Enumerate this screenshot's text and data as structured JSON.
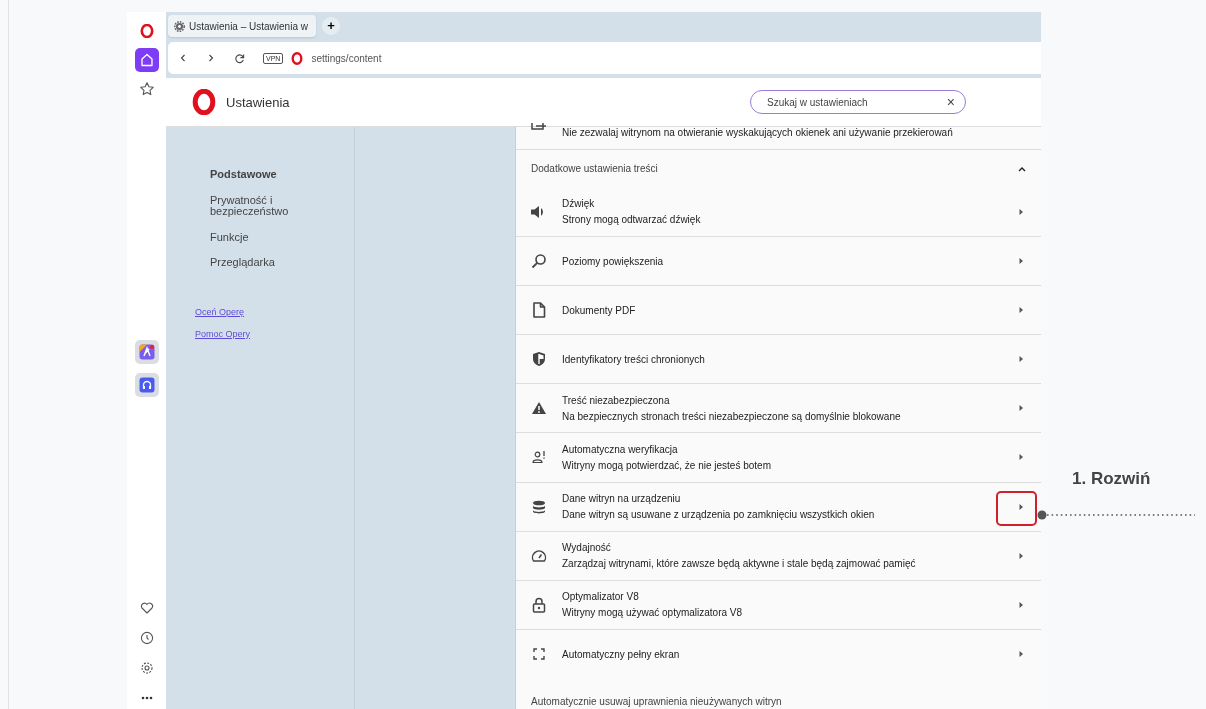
{
  "sidebar": {
    "items": [
      {
        "kind": "logo",
        "selected": false
      },
      {
        "kind": "home",
        "selected": true
      },
      {
        "kind": "star",
        "selected": false
      },
      {
        "kind": "app-a",
        "selected": false
      },
      {
        "kind": "app-b",
        "selected": false
      },
      {
        "kind": "heart",
        "selected": false
      },
      {
        "kind": "clock",
        "selected": false
      },
      {
        "kind": "gear",
        "selected": false
      },
      {
        "kind": "more",
        "selected": false
      }
    ]
  },
  "tabs": [
    {
      "title": "Ustawienia – Ustawienia w",
      "selected": true
    }
  ],
  "new_tab": "+",
  "address": {
    "vpn": "VPN",
    "url": "settings/content"
  },
  "header": {
    "title": "Ustawienia",
    "search_placeholder": "Szukaj w ustawieniach",
    "clear": "×"
  },
  "nav": {
    "items": [
      {
        "label": "Podstawowe",
        "selected": true
      },
      {
        "label": "Prywatność i bezpieczeństwo",
        "selected": false
      },
      {
        "label": "Funkcje",
        "selected": false
      },
      {
        "label": "Przeglądarka",
        "selected": false
      }
    ],
    "links": [
      "Oceń Operę",
      "Pomoc Opery"
    ]
  },
  "content": {
    "partial_row": {
      "subtitle": "Nie zezwalaj witrynom na otwieranie wyskakujących okienek ani używanie przekierowań"
    },
    "section": {
      "title": "Dodatkowe ustawienia treści",
      "expanded": true
    },
    "rows": [
      {
        "kind": "speaker",
        "title": "Dźwięk",
        "subtitle": "Strony mogą odtwarzać dźwięk",
        "highlighted": false
      },
      {
        "kind": "search",
        "title": "Poziomy powiększenia",
        "highlighted": false
      },
      {
        "kind": "file",
        "title": "Dokumenty PDF",
        "highlighted": false
      },
      {
        "kind": "shield",
        "title": "Identyfikatory treści chronionych",
        "highlighted": false
      },
      {
        "kind": "warning",
        "title": "Treść niezabezpieczona",
        "subtitle": "Na bezpiecznych stronach treści niezabezpieczone są domyślnie blokowane",
        "highlighted": false
      },
      {
        "kind": "person",
        "title": "Automatyczna weryfikacja",
        "subtitle": "Witryny mogą potwierdzać, że nie jesteś botem",
        "highlighted": false
      },
      {
        "kind": "database",
        "title": "Dane witryn na urządzeniu",
        "subtitle": "Dane witryn są usuwane z urządzenia po zamknięciu wszystkich okien",
        "highlighted": true
      },
      {
        "kind": "gauge",
        "title": "Wydajność",
        "subtitle": "Zarządzaj witrynami, które zawsze będą aktywne i stale będą zajmować pamięć",
        "highlighted": false
      },
      {
        "kind": "lock",
        "title": "Optymalizator V8",
        "subtitle": "Witryny mogą używać optymalizatora V8",
        "highlighted": false
      },
      {
        "kind": "fullscreen",
        "title": "Automatyczny pełny ekran",
        "highlighted": false
      }
    ],
    "footer_text": "Automatycznie usuwaj uprawnienia nieużywanych witryn"
  },
  "annotation": {
    "label": "1. Rozwiń"
  }
}
